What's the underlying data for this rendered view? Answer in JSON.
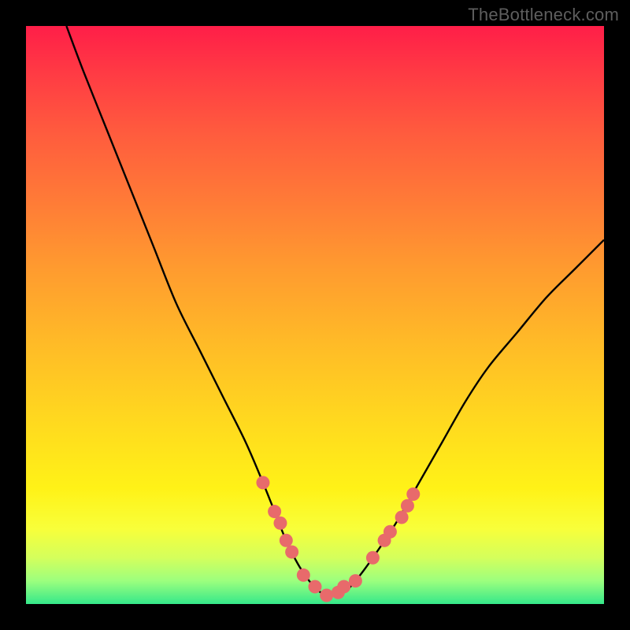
{
  "watermark": "TheBottleneck.com",
  "colors": {
    "frame": "#000000",
    "gradient_top": "#ff1e48",
    "gradient_bottom": "#35e88a",
    "curve": "#000000",
    "dots": "#e86a6b"
  },
  "chart_data": {
    "type": "line",
    "title": "",
    "xlabel": "",
    "ylabel": "",
    "xlim": [
      0,
      100
    ],
    "ylim": [
      0,
      100
    ],
    "series": [
      {
        "name": "curve",
        "x": [
          7,
          10,
          14,
          18,
          22,
          26,
          30,
          34,
          38,
          41,
          43,
          45,
          47,
          49,
          51,
          53,
          55,
          57,
          60,
          64,
          68,
          72,
          76,
          80,
          85,
          90,
          95,
          100
        ],
        "y": [
          100,
          92,
          82,
          72,
          62,
          52,
          44,
          36,
          28,
          21,
          16,
          11,
          7,
          4,
          2,
          1.5,
          2,
          4,
          8,
          14,
          21,
          28,
          35,
          41,
          47,
          53,
          58,
          63
        ]
      }
    ],
    "dots": {
      "name": "highlight-dots",
      "x": [
        41,
        43,
        44,
        45,
        46,
        48,
        50,
        52,
        54,
        55,
        57,
        60,
        62,
        63,
        65,
        66,
        67
      ],
      "y": [
        21,
        16,
        14,
        11,
        9,
        5,
        3,
        1.5,
        2,
        3,
        4,
        8,
        11,
        12.5,
        15,
        17,
        19
      ]
    }
  }
}
